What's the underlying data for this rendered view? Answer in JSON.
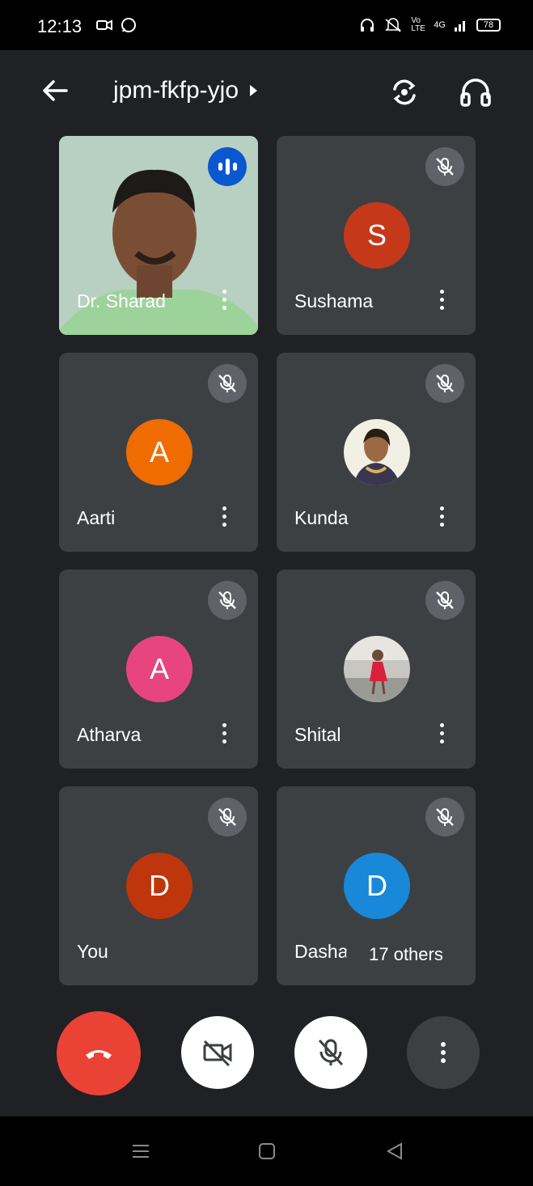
{
  "status_bar": {
    "time": "12:13",
    "network": "4G",
    "volte": "Vo LTE",
    "battery": "78"
  },
  "header": {
    "meeting_code": "jpm-fkfp-yjo"
  },
  "participants": [
    {
      "name": "Dr. Sharad",
      "type": "video",
      "speaking": true
    },
    {
      "name": "Sushama",
      "initial": "S",
      "color": "#c5381a",
      "muted": true
    },
    {
      "name": "Aarti",
      "initial": "A",
      "color": "#ef6c00",
      "muted": true
    },
    {
      "name": "Kunda",
      "type": "photo",
      "muted": true
    },
    {
      "name": "Atharva",
      "initial": "A",
      "color": "#e8457e",
      "muted": true
    },
    {
      "name": "Shital",
      "type": "photo",
      "muted": true
    },
    {
      "name": "You",
      "initial": "D",
      "color": "#bf360c",
      "muted": true
    },
    {
      "name": "Dashar",
      "initial": "D",
      "color": "#1a88d8",
      "muted": true
    }
  ],
  "others_chip": "17 others",
  "colors": {
    "background": "#202124",
    "tile": "#3c4043",
    "end_call": "#ea4335",
    "speaking": "#0b57d0"
  }
}
